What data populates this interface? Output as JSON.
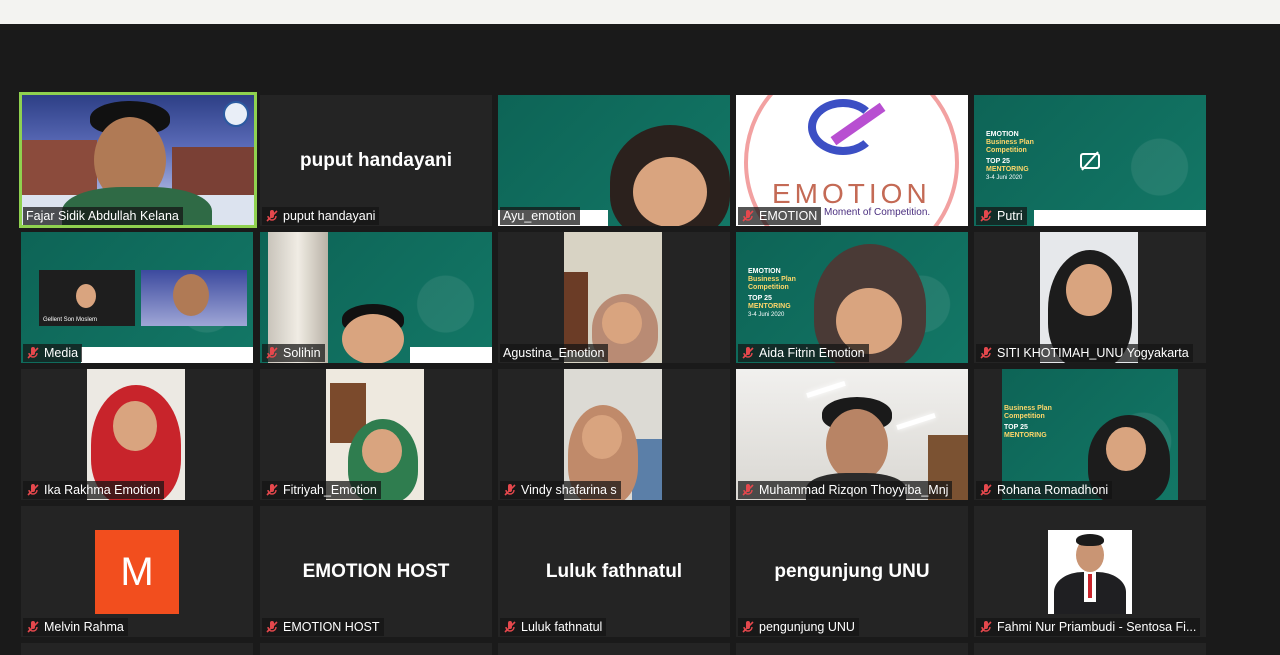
{
  "participants": [
    {
      "name": "Fajar Sidik Abdullah Kelana",
      "mic": "on",
      "type": "video",
      "active": true
    },
    {
      "name": "puput handayani",
      "mic": "muted",
      "type": "name",
      "center": "puput handayani"
    },
    {
      "name": "Ayu_emotion",
      "mic": "on",
      "type": "video"
    },
    {
      "name": "EMOTION",
      "mic": "muted",
      "type": "video",
      "poster_brand": "EMOTION",
      "poster_tagline": "Moment of Competition."
    },
    {
      "name": "Putri",
      "mic": "muted",
      "type": "video",
      "poster_lines": [
        "EMOTION",
        "Business Plan",
        "Competition",
        "TOP 25",
        "MENTORING",
        "3-4 Juni 2020"
      ]
    },
    {
      "name": "Media",
      "mic": "muted",
      "type": "video",
      "inner_caption": "Gellent Son Moslem"
    },
    {
      "name": "Solihin",
      "mic": "muted",
      "type": "video"
    },
    {
      "name": "Agustina_Emotion",
      "mic": "on",
      "type": "video"
    },
    {
      "name": "Aida Fitrin Emotion",
      "mic": "muted",
      "type": "video",
      "poster_lines": [
        "EMOTION",
        "Business Plan",
        "Competition",
        "TOP 25",
        "MENTORING",
        "3-4 Juni 2020"
      ]
    },
    {
      "name": "SITI KHOTIMAH_UNU Yogyakarta",
      "mic": "muted",
      "type": "video"
    },
    {
      "name": "Ika Rakhma Emotion",
      "mic": "muted",
      "type": "video"
    },
    {
      "name": "Fitriyah_Emotion",
      "mic": "muted",
      "type": "video"
    },
    {
      "name": "Vindy shafarina s",
      "mic": "muted",
      "type": "video"
    },
    {
      "name": "Muhammad Rizqon Thoyyiba_Mnj",
      "mic": "muted",
      "type": "video"
    },
    {
      "name": "Rohana Romadhoni",
      "mic": "muted",
      "type": "video",
      "poster_lines": [
        "Business Plan",
        "Competition",
        "TOP 25",
        "MENTORING"
      ]
    },
    {
      "name": "Melvin Rahma",
      "mic": "muted",
      "type": "avatar",
      "initial": "M"
    },
    {
      "name": "EMOTION HOST",
      "mic": "muted",
      "type": "name",
      "center": "EMOTION HOST"
    },
    {
      "name": "Luluk fathnatul",
      "mic": "muted",
      "type": "name",
      "center": "Luluk fathnatul"
    },
    {
      "name": "pengunjung UNU",
      "mic": "muted",
      "type": "name",
      "center": "pengunjung UNU"
    },
    {
      "name": "Fahmi Nur Priambudi - Sentosa Fi...",
      "mic": "muted",
      "type": "photo"
    }
  ],
  "colors": {
    "background": "#1a1a1a",
    "tile": "#242424",
    "active_border": "#8fd14f",
    "mic_muted": "#e5484d",
    "teal": "#0f6a5c",
    "avatar_orange": "#f24e1e"
  },
  "icons": {
    "mic_muted": "muted-mic-icon",
    "mic_on": "mic-icon",
    "camera_off": "camera-off-icon"
  }
}
